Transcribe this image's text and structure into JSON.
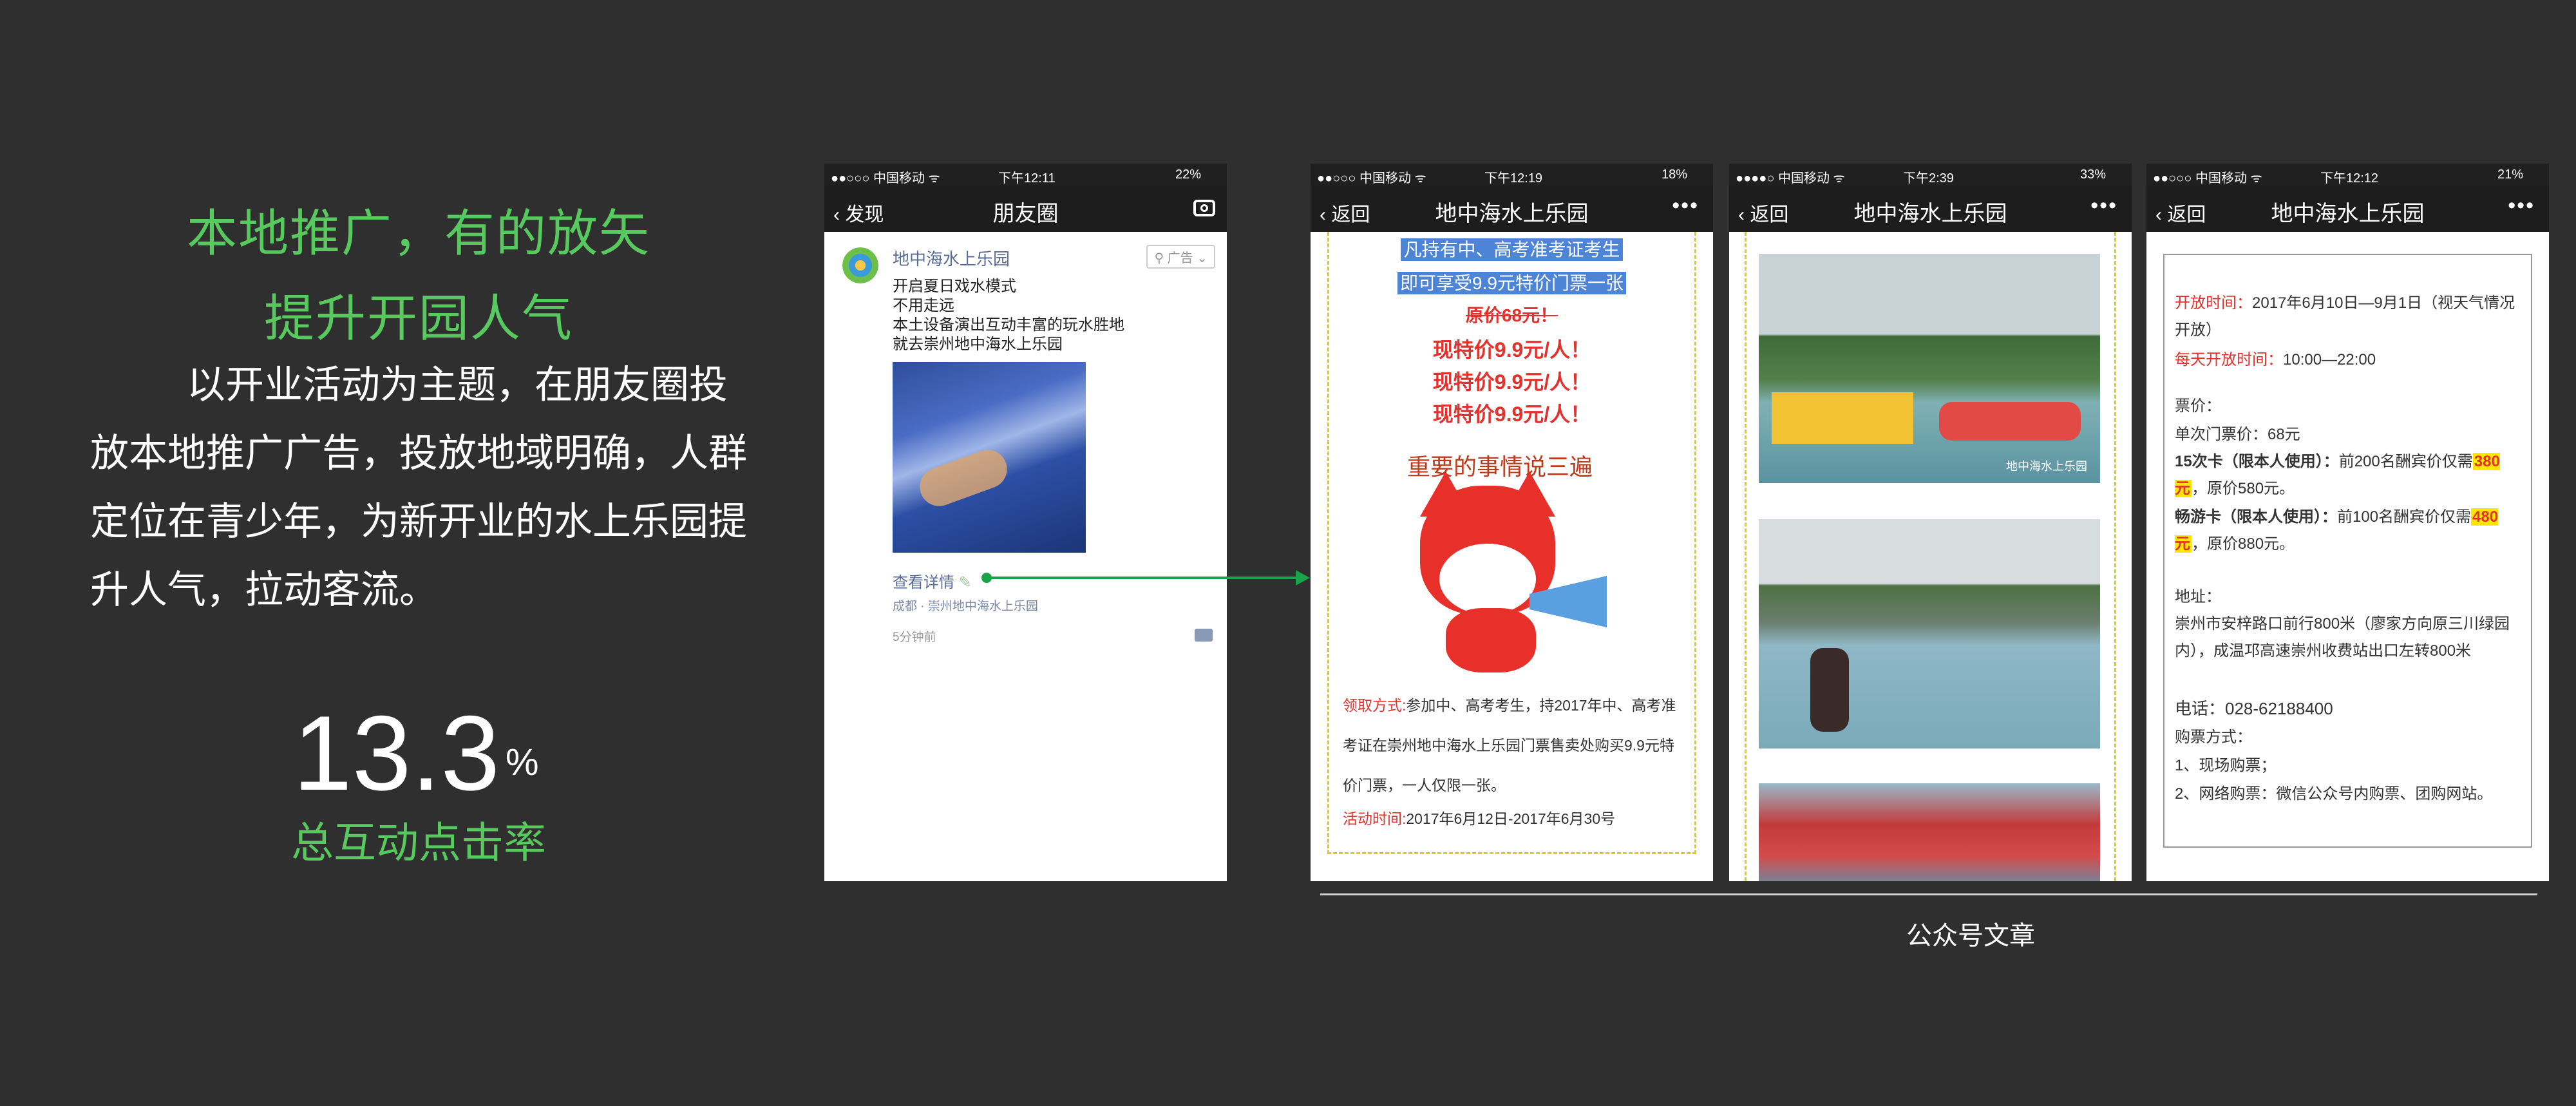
{
  "left": {
    "headline1": "本地推广，有的放矢",
    "headline2": "提升开园人气",
    "body": "以开业活动为主题，在朋友圈投放本地推广广告，投放地域明确，人群定位在青少年，为新开业的水上乐园提升人气，拉动客流。",
    "rate_value": "13.3",
    "rate_unit": "%",
    "rate_label": "总互动点击率"
  },
  "moments": {
    "status": {
      "carrier": "●●○○○ 中国移动 ᯤ",
      "time": "下午12:11",
      "battery": "22%"
    },
    "back_label": "发现",
    "title": "朋友圈",
    "author": "地中海水上乐园",
    "ad_tag": "广告",
    "lines": [
      "开启夏日戏水模式",
      "不用走远",
      "本土设备演出互动丰富的玩水胜地",
      "就去崇州地中海水上乐园"
    ],
    "detail_link": "查看详情",
    "location": "成都 · 崇州地中海水上乐园",
    "time_ago": "5分钟前"
  },
  "article1": {
    "status": {
      "carrier": "●●○○○ 中国移动 ᯤ",
      "time": "下午12:19",
      "battery": "18%"
    },
    "back_label": "返回",
    "title": "地中海水上乐园",
    "highlight1": "凡持有中、高考准考证考生",
    "highlight2": "即可享受9.9元特价门票一张",
    "original_price": "原价68元！",
    "price_lines": [
      "现特价9.9元/人！",
      "现特价9.9元/人！",
      "现特价9.9元/人！"
    ],
    "mascot_caption": "重要的事情说三遍",
    "claim_label": "领取方式:",
    "claim_text": "参加中、高考考生，持2017年中、高考准考证在崇州地中海水上乐园门票售卖处购买9.9元特价门票，一人仅限一张。",
    "period_label": "活动时间:",
    "period_text": "2017年6月12日-2017年6月30号"
  },
  "article2": {
    "status": {
      "carrier": "●●●●○ 中国移动 ᯤ",
      "time": "下午2:39",
      "battery": "33%"
    },
    "back_label": "返回",
    "title": "地中海水上乐园",
    "watermark": "地中海水上乐园"
  },
  "article3": {
    "status": {
      "carrier": "●●○○○ 中国移动 ᯤ",
      "time": "下午12:12",
      "battery": "21%"
    },
    "back_label": "返回",
    "title": "地中海水上乐园",
    "open_label": "开放时间：",
    "open_text": "2017年6月10日—9月1日（视天气情况开放）",
    "daily_label": "每天开放时间：",
    "daily_text": "10:00—22:00",
    "ticket_label": "票价：",
    "single": "单次门票价：68元",
    "card15_prefix": "15次卡（限本人使用）：",
    "card15_text1": "前200名酬宾价仅需",
    "card15_hl": "380元",
    "card15_text2": "，原价580元。",
    "pass_prefix": "畅游卡（限本人使用）：",
    "pass_text1": "前100名酬宾价仅需",
    "pass_hl": "480元",
    "pass_text2": "，原价880元。",
    "addr_label": "地址：",
    "addr_text": "崇州市安梓路口前行800米（廖家方向原三川绿园内），成温邛高速崇州收费站出口左转800米",
    "phone": "电话：028-62188400",
    "buy_label": "购票方式：",
    "buy1": "1、现场购票；",
    "buy2": "2、网络购票：微信公众号内购票、团购网站。"
  },
  "caption": "公众号文章"
}
